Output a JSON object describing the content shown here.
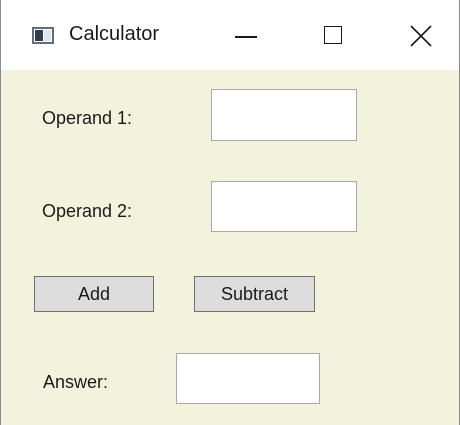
{
  "window": {
    "title": "Calculator",
    "icon": "calculator-app-icon",
    "controls": {
      "minimize": "minimize-icon",
      "maximize": "maximize-icon",
      "close": "close-icon"
    }
  },
  "form": {
    "operand1_label": "Operand 1:",
    "operand1_value": "",
    "operand2_label": "Operand 2:",
    "operand2_value": "",
    "add_label": "Add",
    "subtract_label": "Subtract",
    "answer_label": "Answer:",
    "answer_value": ""
  },
  "colors": {
    "client_background": "#f3f3dd",
    "button_face": "#dddddd",
    "button_border": "#707070"
  }
}
